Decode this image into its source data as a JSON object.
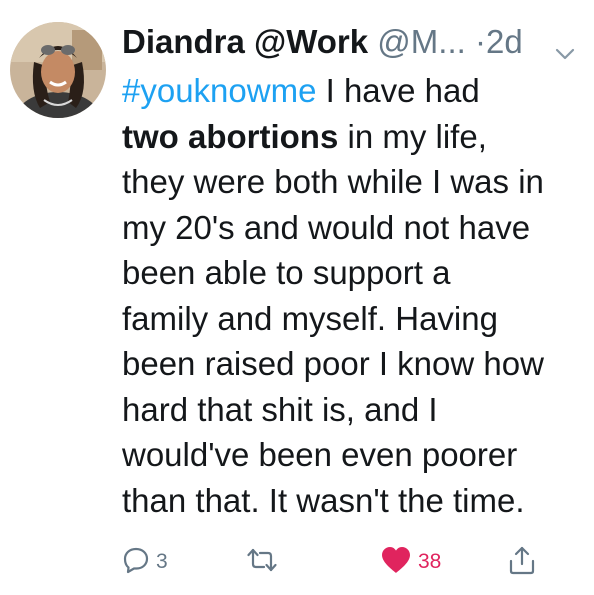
{
  "tweet": {
    "display_name": "Diandra @Work",
    "handle": "@M...",
    "separator": "·",
    "timestamp": "2d",
    "text_lines": [
      {
        "parts": [
          {
            "text": "#youknowme",
            "style": "hashtag"
          },
          {
            "text": " I have had",
            "style": "normal"
          }
        ]
      },
      {
        "parts": [
          {
            "text": "two abortions",
            "style": "bold"
          },
          {
            "text": " in my life,",
            "style": "normal"
          }
        ]
      },
      {
        "parts": [
          {
            "text": "they were both while I was in",
            "style": "normal"
          }
        ]
      },
      {
        "parts": [
          {
            "text": "my 20's and would not have",
            "style": "normal"
          }
        ]
      },
      {
        "parts": [
          {
            "text": "been able to support a",
            "style": "normal"
          }
        ]
      },
      {
        "parts": [
          {
            "text": "family and myself. Having",
            "style": "normal"
          }
        ]
      },
      {
        "parts": [
          {
            "text": "been raised poor I know how",
            "style": "normal"
          }
        ]
      },
      {
        "parts": [
          {
            "text": "hard that shit is, and I",
            "style": "normal"
          }
        ]
      },
      {
        "parts": [
          {
            "text": "would've been even poorer",
            "style": "normal"
          }
        ]
      },
      {
        "parts": [
          {
            "text": "than that. It wasn't the time.",
            "style": "normal"
          }
        ]
      }
    ],
    "actions": {
      "reply_count": "3",
      "retweet_count": "",
      "like_count": "38",
      "like_state": "liked"
    },
    "icons": {
      "reply": "reply-icon",
      "retweet": "retweet-icon",
      "like": "heart-icon",
      "share": "share-icon",
      "menu": "chevron-down-icon"
    }
  },
  "colors": {
    "text": "#14171a",
    "muted": "#657786",
    "link": "#1da1f2",
    "like": "#e0245e"
  }
}
